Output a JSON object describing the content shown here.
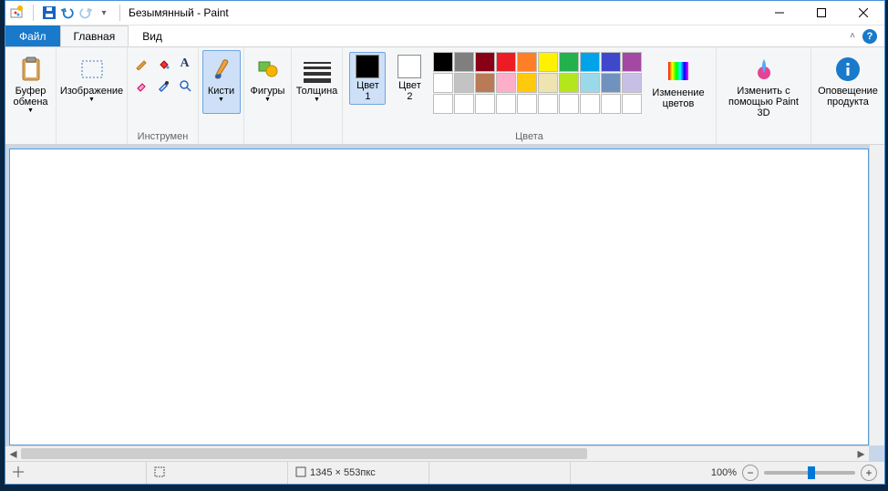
{
  "title": "Безымянный - Paint",
  "tabs": {
    "file": "Файл",
    "home": "Главная",
    "view": "Вид"
  },
  "ribbon": {
    "clipboard": {
      "big": "Буфер\nобмена",
      "label": ""
    },
    "image": {
      "big": "Изображение",
      "label": ""
    },
    "tools": {
      "label": "Инструмен"
    },
    "brushes": {
      "big": "Кисти"
    },
    "shapes": {
      "big": "Фигуры"
    },
    "size": {
      "big": "Толщина"
    },
    "color1": {
      "big": "Цвет\n1"
    },
    "color2": {
      "big": "Цвет\n2"
    },
    "editcolors": {
      "big": "Изменение\nцветов"
    },
    "colors_label": "Цвета",
    "paint3d": {
      "big": "Изменить с\nпомощью Paint 3D"
    },
    "alert": {
      "big": "Оповещение\nпродукта"
    }
  },
  "palette": {
    "row1": [
      "#000000",
      "#7f7f7f",
      "#880015",
      "#ed1c24",
      "#ff7f27",
      "#fff200",
      "#22b14c",
      "#00a2e8",
      "#3f48cc",
      "#a349a4"
    ],
    "row2": [
      "#ffffff",
      "#c3c3c3",
      "#b97a57",
      "#ffaec9",
      "#ffc90e",
      "#efe4b0",
      "#b5e61d",
      "#99d9ea",
      "#7092be",
      "#c8bfe7"
    ],
    "row3": [
      "#ffffff",
      "#ffffff",
      "#ffffff",
      "#ffffff",
      "#ffffff",
      "#ffffff",
      "#ffffff",
      "#ffffff",
      "#ffffff",
      "#ffffff"
    ]
  },
  "current_colors": {
    "c1": "#000000",
    "c2": "#ffffff"
  },
  "status": {
    "dimensions": "1345 × 553пкс",
    "zoom": "100%"
  }
}
